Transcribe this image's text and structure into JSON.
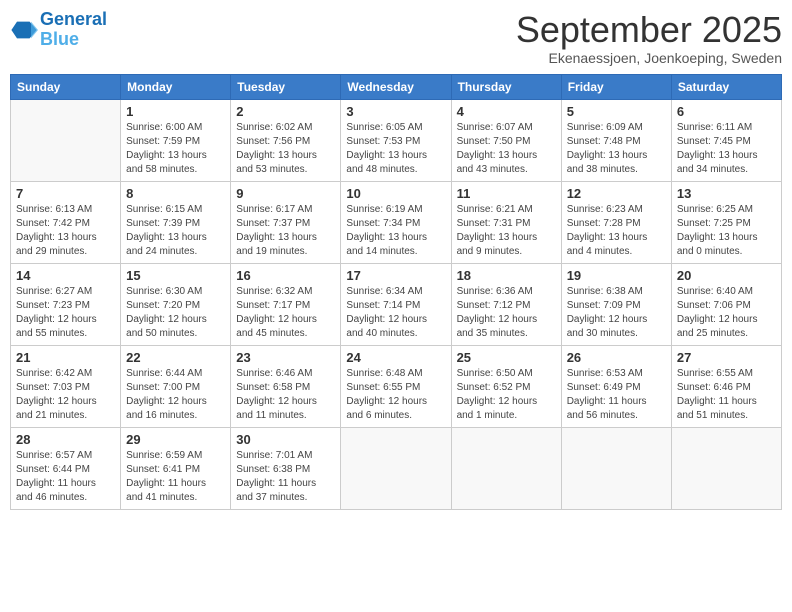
{
  "header": {
    "logo_line1": "General",
    "logo_line2": "Blue",
    "month": "September 2025",
    "location": "Ekenaessjoen, Joenkoeping, Sweden"
  },
  "weekdays": [
    "Sunday",
    "Monday",
    "Tuesday",
    "Wednesday",
    "Thursday",
    "Friday",
    "Saturday"
  ],
  "weeks": [
    [
      {
        "day": "",
        "sunrise": "",
        "sunset": "",
        "daylight": ""
      },
      {
        "day": "1",
        "sunrise": "Sunrise: 6:00 AM",
        "sunset": "Sunset: 7:59 PM",
        "daylight": "Daylight: 13 hours and 58 minutes."
      },
      {
        "day": "2",
        "sunrise": "Sunrise: 6:02 AM",
        "sunset": "Sunset: 7:56 PM",
        "daylight": "Daylight: 13 hours and 53 minutes."
      },
      {
        "day": "3",
        "sunrise": "Sunrise: 6:05 AM",
        "sunset": "Sunset: 7:53 PM",
        "daylight": "Daylight: 13 hours and 48 minutes."
      },
      {
        "day": "4",
        "sunrise": "Sunrise: 6:07 AM",
        "sunset": "Sunset: 7:50 PM",
        "daylight": "Daylight: 13 hours and 43 minutes."
      },
      {
        "day": "5",
        "sunrise": "Sunrise: 6:09 AM",
        "sunset": "Sunset: 7:48 PM",
        "daylight": "Daylight: 13 hours and 38 minutes."
      },
      {
        "day": "6",
        "sunrise": "Sunrise: 6:11 AM",
        "sunset": "Sunset: 7:45 PM",
        "daylight": "Daylight: 13 hours and 34 minutes."
      }
    ],
    [
      {
        "day": "7",
        "sunrise": "Sunrise: 6:13 AM",
        "sunset": "Sunset: 7:42 PM",
        "daylight": "Daylight: 13 hours and 29 minutes."
      },
      {
        "day": "8",
        "sunrise": "Sunrise: 6:15 AM",
        "sunset": "Sunset: 7:39 PM",
        "daylight": "Daylight: 13 hours and 24 minutes."
      },
      {
        "day": "9",
        "sunrise": "Sunrise: 6:17 AM",
        "sunset": "Sunset: 7:37 PM",
        "daylight": "Daylight: 13 hours and 19 minutes."
      },
      {
        "day": "10",
        "sunrise": "Sunrise: 6:19 AM",
        "sunset": "Sunset: 7:34 PM",
        "daylight": "Daylight: 13 hours and 14 minutes."
      },
      {
        "day": "11",
        "sunrise": "Sunrise: 6:21 AM",
        "sunset": "Sunset: 7:31 PM",
        "daylight": "Daylight: 13 hours and 9 minutes."
      },
      {
        "day": "12",
        "sunrise": "Sunrise: 6:23 AM",
        "sunset": "Sunset: 7:28 PM",
        "daylight": "Daylight: 13 hours and 4 minutes."
      },
      {
        "day": "13",
        "sunrise": "Sunrise: 6:25 AM",
        "sunset": "Sunset: 7:25 PM",
        "daylight": "Daylight: 13 hours and 0 minutes."
      }
    ],
    [
      {
        "day": "14",
        "sunrise": "Sunrise: 6:27 AM",
        "sunset": "Sunset: 7:23 PM",
        "daylight": "Daylight: 12 hours and 55 minutes."
      },
      {
        "day": "15",
        "sunrise": "Sunrise: 6:30 AM",
        "sunset": "Sunset: 7:20 PM",
        "daylight": "Daylight: 12 hours and 50 minutes."
      },
      {
        "day": "16",
        "sunrise": "Sunrise: 6:32 AM",
        "sunset": "Sunset: 7:17 PM",
        "daylight": "Daylight: 12 hours and 45 minutes."
      },
      {
        "day": "17",
        "sunrise": "Sunrise: 6:34 AM",
        "sunset": "Sunset: 7:14 PM",
        "daylight": "Daylight: 12 hours and 40 minutes."
      },
      {
        "day": "18",
        "sunrise": "Sunrise: 6:36 AM",
        "sunset": "Sunset: 7:12 PM",
        "daylight": "Daylight: 12 hours and 35 minutes."
      },
      {
        "day": "19",
        "sunrise": "Sunrise: 6:38 AM",
        "sunset": "Sunset: 7:09 PM",
        "daylight": "Daylight: 12 hours and 30 minutes."
      },
      {
        "day": "20",
        "sunrise": "Sunrise: 6:40 AM",
        "sunset": "Sunset: 7:06 PM",
        "daylight": "Daylight: 12 hours and 25 minutes."
      }
    ],
    [
      {
        "day": "21",
        "sunrise": "Sunrise: 6:42 AM",
        "sunset": "Sunset: 7:03 PM",
        "daylight": "Daylight: 12 hours and 21 minutes."
      },
      {
        "day": "22",
        "sunrise": "Sunrise: 6:44 AM",
        "sunset": "Sunset: 7:00 PM",
        "daylight": "Daylight: 12 hours and 16 minutes."
      },
      {
        "day": "23",
        "sunrise": "Sunrise: 6:46 AM",
        "sunset": "Sunset: 6:58 PM",
        "daylight": "Daylight: 12 hours and 11 minutes."
      },
      {
        "day": "24",
        "sunrise": "Sunrise: 6:48 AM",
        "sunset": "Sunset: 6:55 PM",
        "daylight": "Daylight: 12 hours and 6 minutes."
      },
      {
        "day": "25",
        "sunrise": "Sunrise: 6:50 AM",
        "sunset": "Sunset: 6:52 PM",
        "daylight": "Daylight: 12 hours and 1 minute."
      },
      {
        "day": "26",
        "sunrise": "Sunrise: 6:53 AM",
        "sunset": "Sunset: 6:49 PM",
        "daylight": "Daylight: 11 hours and 56 minutes."
      },
      {
        "day": "27",
        "sunrise": "Sunrise: 6:55 AM",
        "sunset": "Sunset: 6:46 PM",
        "daylight": "Daylight: 11 hours and 51 minutes."
      }
    ],
    [
      {
        "day": "28",
        "sunrise": "Sunrise: 6:57 AM",
        "sunset": "Sunset: 6:44 PM",
        "daylight": "Daylight: 11 hours and 46 minutes."
      },
      {
        "day": "29",
        "sunrise": "Sunrise: 6:59 AM",
        "sunset": "Sunset: 6:41 PM",
        "daylight": "Daylight: 11 hours and 41 minutes."
      },
      {
        "day": "30",
        "sunrise": "Sunrise: 7:01 AM",
        "sunset": "Sunset: 6:38 PM",
        "daylight": "Daylight: 11 hours and 37 minutes."
      },
      {
        "day": "",
        "sunrise": "",
        "sunset": "",
        "daylight": ""
      },
      {
        "day": "",
        "sunrise": "",
        "sunset": "",
        "daylight": ""
      },
      {
        "day": "",
        "sunrise": "",
        "sunset": "",
        "daylight": ""
      },
      {
        "day": "",
        "sunrise": "",
        "sunset": "",
        "daylight": ""
      }
    ]
  ]
}
